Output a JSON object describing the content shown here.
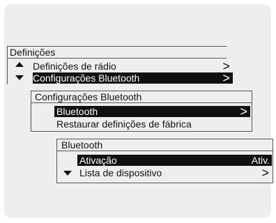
{
  "menu1": {
    "title": "Definições",
    "items": [
      {
        "label": "Definições de rádio",
        "chevron": ">"
      },
      {
        "label": "Configurações Bluetooth",
        "chevron": ">"
      }
    ]
  },
  "menu2": {
    "title": "Configurações Bluetooth",
    "items": [
      {
        "label": "Bluetooth",
        "chevron": ">"
      },
      {
        "label": "Restaurar definições de fábrica"
      }
    ]
  },
  "menu3": {
    "title": "Bluetooth",
    "items": [
      {
        "label": "Ativação",
        "value": "Ativ."
      },
      {
        "label": "Lista de dispositivo",
        "chevron": ">"
      }
    ]
  },
  "icons": {
    "scroll_up": "triangle-up-icon",
    "scroll_down": "triangle-down-icon"
  },
  "colors": {
    "background": "#eeeeee",
    "selected_bg": "#111111",
    "selected_fg": "#ffffff",
    "border": "#555555"
  }
}
